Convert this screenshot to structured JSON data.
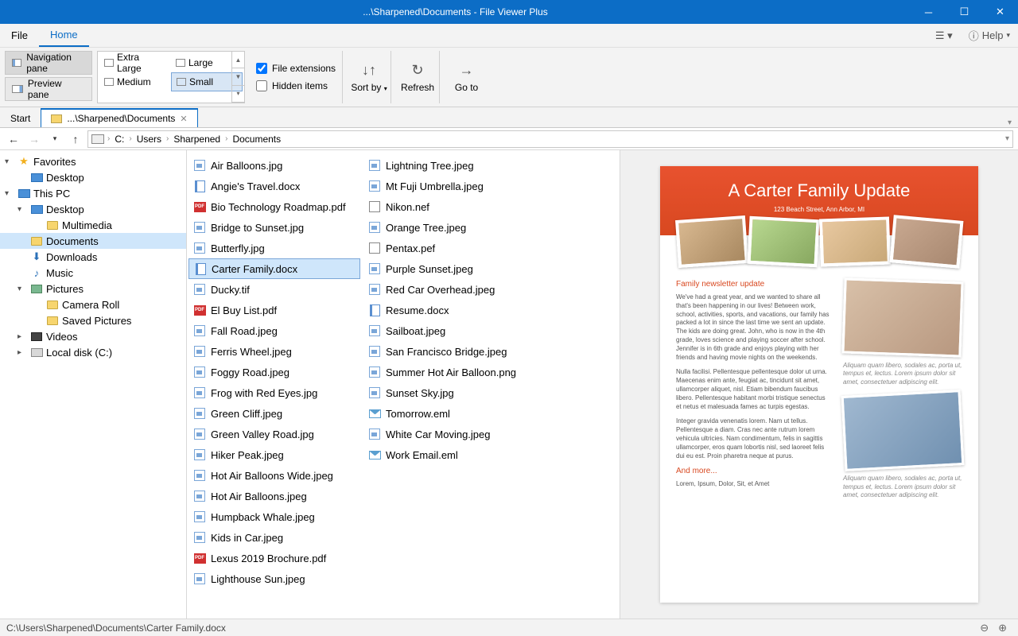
{
  "titlebar": {
    "title": "...\\Sharpened\\Documents - File Viewer Plus"
  },
  "menu": {
    "file": "File",
    "home": "Home",
    "help": "Help"
  },
  "ribbon": {
    "nav_pane": "Navigation pane",
    "preview_pane": "Preview pane",
    "view": {
      "extra_large": "Extra Large",
      "large": "Large",
      "medium": "Medium",
      "small": "Small"
    },
    "file_ext": "File extensions",
    "hidden": "Hidden items",
    "sort_by": "Sort by",
    "refresh": "Refresh",
    "go_to": "Go to"
  },
  "tabs": {
    "start": "Start",
    "path": "...\\Sharpened\\Documents"
  },
  "breadcrumbs": [
    "C:",
    "Users",
    "Sharpened",
    "Documents"
  ],
  "tree": {
    "favorites": "Favorites",
    "desktop_fav": "Desktop",
    "this_pc": "This PC",
    "desktop": "Desktop",
    "multimedia": "Multimedia",
    "documents": "Documents",
    "downloads": "Downloads",
    "music": "Music",
    "pictures": "Pictures",
    "camera_roll": "Camera Roll",
    "saved_pictures": "Saved Pictures",
    "videos": "Videos",
    "local_disk": "Local disk (C:)"
  },
  "files_col1": [
    {
      "n": "Air Balloons.jpg",
      "t": "img"
    },
    {
      "n": "Angie's Travel.docx",
      "t": "doc"
    },
    {
      "n": "Bio Technology Roadmap.pdf",
      "t": "pdf"
    },
    {
      "n": "Bridge to Sunset.jpg",
      "t": "img"
    },
    {
      "n": "Butterfly.jpg",
      "t": "img"
    },
    {
      "n": "Carter Family.docx",
      "t": "doc",
      "sel": true
    },
    {
      "n": "Ducky.tif",
      "t": "img"
    },
    {
      "n": "El Buy List.pdf",
      "t": "pdf"
    },
    {
      "n": "Fall Road.jpeg",
      "t": "img"
    },
    {
      "n": "Ferris Wheel.jpeg",
      "t": "img"
    },
    {
      "n": "Foggy Road.jpeg",
      "t": "img"
    },
    {
      "n": "Frog with Red Eyes.jpg",
      "t": "img"
    },
    {
      "n": "Green Cliff.jpeg",
      "t": "img"
    },
    {
      "n": "Green Valley Road.jpg",
      "t": "img"
    },
    {
      "n": "Hiker Peak.jpeg",
      "t": "img"
    },
    {
      "n": "Hot Air Balloons Wide.jpeg",
      "t": "img"
    },
    {
      "n": "Hot Air Balloons.jpeg",
      "t": "img"
    },
    {
      "n": "Humpback Whale.jpeg",
      "t": "img"
    },
    {
      "n": "Kids in Car.jpeg",
      "t": "img"
    },
    {
      "n": "Lexus 2019 Brochure.pdf",
      "t": "pdf"
    },
    {
      "n": "Lighthouse Sun.jpeg",
      "t": "img"
    }
  ],
  "files_col2": [
    {
      "n": "Lightning Tree.jpeg",
      "t": "img"
    },
    {
      "n": "Mt Fuji Umbrella.jpeg",
      "t": "img"
    },
    {
      "n": "Nikon.nef",
      "t": "raw"
    },
    {
      "n": "Orange Tree.jpeg",
      "t": "img"
    },
    {
      "n": "Pentax.pef",
      "t": "raw"
    },
    {
      "n": "Purple Sunset.jpeg",
      "t": "img"
    },
    {
      "n": "Red Car Overhead.jpeg",
      "t": "img"
    },
    {
      "n": "Resume.docx",
      "t": "doc"
    },
    {
      "n": "Sailboat.jpeg",
      "t": "img"
    },
    {
      "n": "San Francisco Bridge.jpeg",
      "t": "img"
    },
    {
      "n": "Summer Hot Air Balloon.png",
      "t": "img"
    },
    {
      "n": "Sunset Sky.jpg",
      "t": "img"
    },
    {
      "n": "Tomorrow.eml",
      "t": "eml"
    },
    {
      "n": "White Car Moving.jpeg",
      "t": "img"
    },
    {
      "n": "Work Email.eml",
      "t": "eml"
    }
  ],
  "preview": {
    "title": "A Carter Family Update",
    "subtitle": "123 Beach Street, Ann Arbor, MI",
    "h2": "Family newsletter update",
    "p1": "We've had a great year, and we wanted to share all that's been happening in our lives! Between work, school, activities, sports, and vacations, our family has packed a lot in since the last time we sent an update. The kids are doing great. John, who is now in the 4th grade, loves science and playing soccer after school. Jennifer is in 6th grade and enjoys playing with her friends and having movie nights on the weekends.",
    "p2": "Nulla facilisi. Pellentesque pellentesque dolor ut urna. Maecenas enim ante, feugiat ac, tincidunt sit amet, ullamcorper aliquet, nisl. Etiam bibendum faucibus libero. Pellentesque habitant morbi tristique senectus et netus et malesuada fames ac turpis egestas.",
    "p3": "Integer gravida venenatis lorem. Nam ut tellus. Pellentesque a diam. Cras nec ante rutrum lorem vehicula ultricies. Nam condimentum, felis in sagittis ullamcorper, eros quam lobortis nisl, sed laoreet felis dui eu est. Proin pharetra neque at purus.",
    "h3": "And more...",
    "p4": "Lorem, Ipsum, Dolor, Sit, et Amet",
    "cap1": "Aliquam quam libero, sodales ac, porta ut, tempus et, lectus. Lorem ipsum dolor sit amet, consectetuer adipiscing elit.",
    "cap2": "Aliquam quam libero, sodales ac, porta ut, tempus et, lectus. Lorem ipsum dolor sit amet, consectetuer adipiscing elit."
  },
  "status": {
    "path": "C:\\Users\\Sharpened\\Documents\\Carter Family.docx"
  }
}
